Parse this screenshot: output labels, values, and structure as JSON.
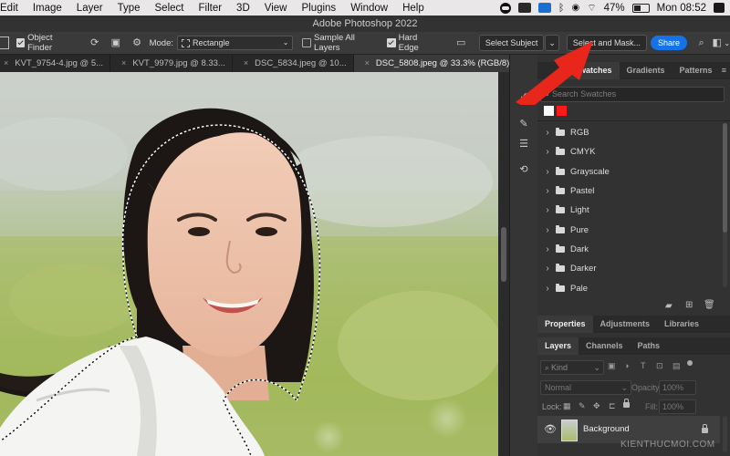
{
  "menubar": {
    "items": [
      "Edit",
      "Image",
      "Layer",
      "Type",
      "Select",
      "Filter",
      "3D",
      "View",
      "Plugins",
      "Window",
      "Help"
    ],
    "battery": "47%",
    "clock": "Mon 08:52"
  },
  "window": {
    "title": "Adobe Photoshop 2022"
  },
  "options": {
    "object_finder": "Object Finder",
    "mode_label": "Mode:",
    "mode_value": "Rectangle",
    "sample_all_layers": "Sample All Layers",
    "hard_edge": "Hard Edge",
    "select_subject": "Select Subject",
    "select_and_mask": "Select and Mask...",
    "share": "Share"
  },
  "tabs": [
    {
      "label": "KVT_9754-4.jpg @ 5..."
    },
    {
      "label": "KVT_9979.jpg @ 8.33..."
    },
    {
      "label": "DSC_5834.jpeg @ 10..."
    },
    {
      "label": "DSC_5808.jpeg @ 33.3% (RGB/8) *"
    }
  ],
  "swatches_panel": {
    "tabs": [
      "Swatches",
      "Gradients",
      "Patterns"
    ],
    "search_placeholder": "Search Swatches",
    "recent_colors": [
      "#ffffff",
      "#ff1a1a"
    ],
    "groups": [
      "RGB",
      "CMYK",
      "Grayscale",
      "Pastel",
      "Light",
      "Pure",
      "Dark",
      "Darker",
      "Pale"
    ]
  },
  "properties_panel": {
    "tabs": [
      "Properties",
      "Adjustments",
      "Libraries"
    ]
  },
  "layers_panel": {
    "tabs": [
      "Layers",
      "Channels",
      "Paths"
    ],
    "kind_label": "Kind",
    "blend_mode": "Normal",
    "opacity_label": "Opacity:",
    "opacity_value": "100%",
    "lock_label": "Lock:",
    "fill_label": "Fill:",
    "fill_value": "100%",
    "layer_name": "Background"
  },
  "watermark": "KIENTHUCMOI.COM",
  "colors": {
    "accent": "#1473e6",
    "arrow": "#e8261b"
  }
}
